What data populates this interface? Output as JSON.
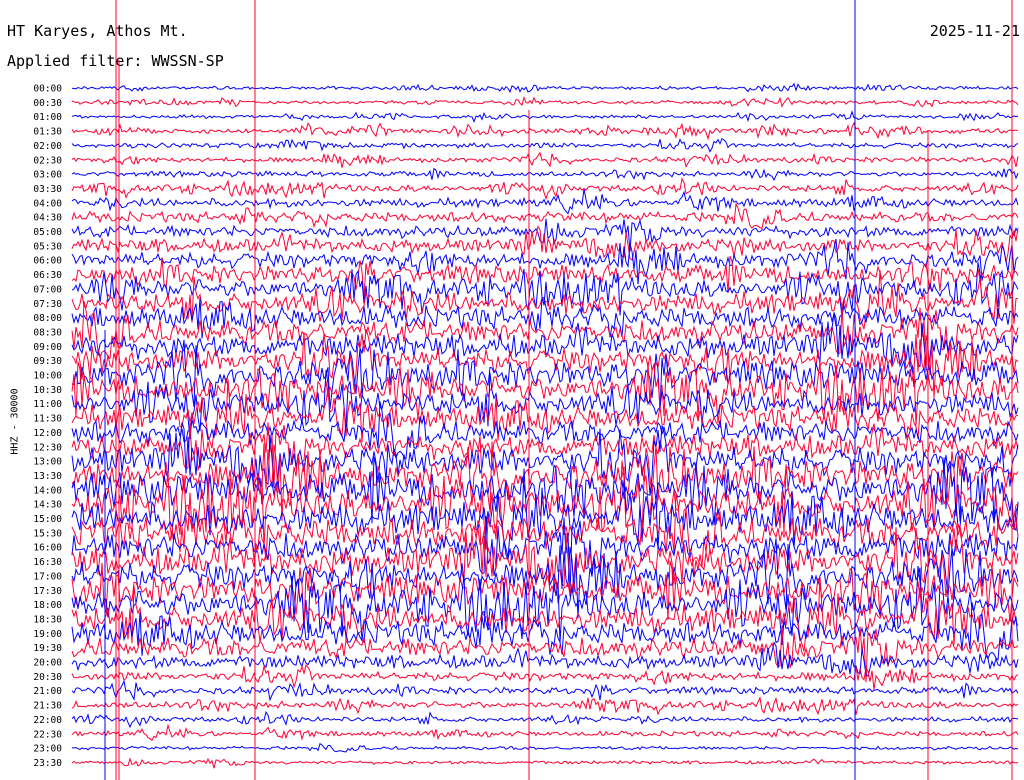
{
  "header": {
    "station": "HT Karyes, Athos Mt.",
    "date": "2025-11-21",
    "filter": "Applied filter: WWSSN-SP"
  },
  "chart_data": {
    "type": "line",
    "title": "HT Karyes, Athos Mt.",
    "ylabel": "HHZ - 30000",
    "y_ticks": [
      "00:00",
      "00:30",
      "01:00",
      "01:30",
      "02:00",
      "02:30",
      "03:00",
      "03:30",
      "04:00",
      "04:30",
      "05:00",
      "05:30",
      "06:00",
      "06:30",
      "07:00",
      "07:30",
      "08:00",
      "08:30",
      "09:00",
      "09:30",
      "10:00",
      "10:30",
      "11:00",
      "11:30",
      "12:00",
      "12:30",
      "13:00",
      "13:30",
      "14:00",
      "14:30",
      "15:00",
      "15:30",
      "16:00",
      "16:30",
      "17:00",
      "17:30",
      "18:00",
      "18:30",
      "19:00",
      "19:30",
      "20:00",
      "20:30",
      "21:00",
      "21:30",
      "22:00",
      "22:30",
      "23:00",
      "23:30"
    ],
    "row_amplitude": [
      2,
      2,
      2,
      3,
      3,
      3,
      3,
      4,
      5,
      6,
      7,
      8,
      9,
      10,
      11,
      12,
      13,
      14,
      14,
      14,
      15,
      15,
      14,
      14,
      14,
      14,
      16,
      17,
      18,
      18,
      18,
      18,
      17,
      17,
      16,
      16,
      16,
      15,
      14,
      12,
      8,
      5,
      4,
      4,
      3,
      3,
      2,
      2
    ],
    "colors": [
      "#0000ff",
      "#ff0033"
    ],
    "grid": false
  }
}
